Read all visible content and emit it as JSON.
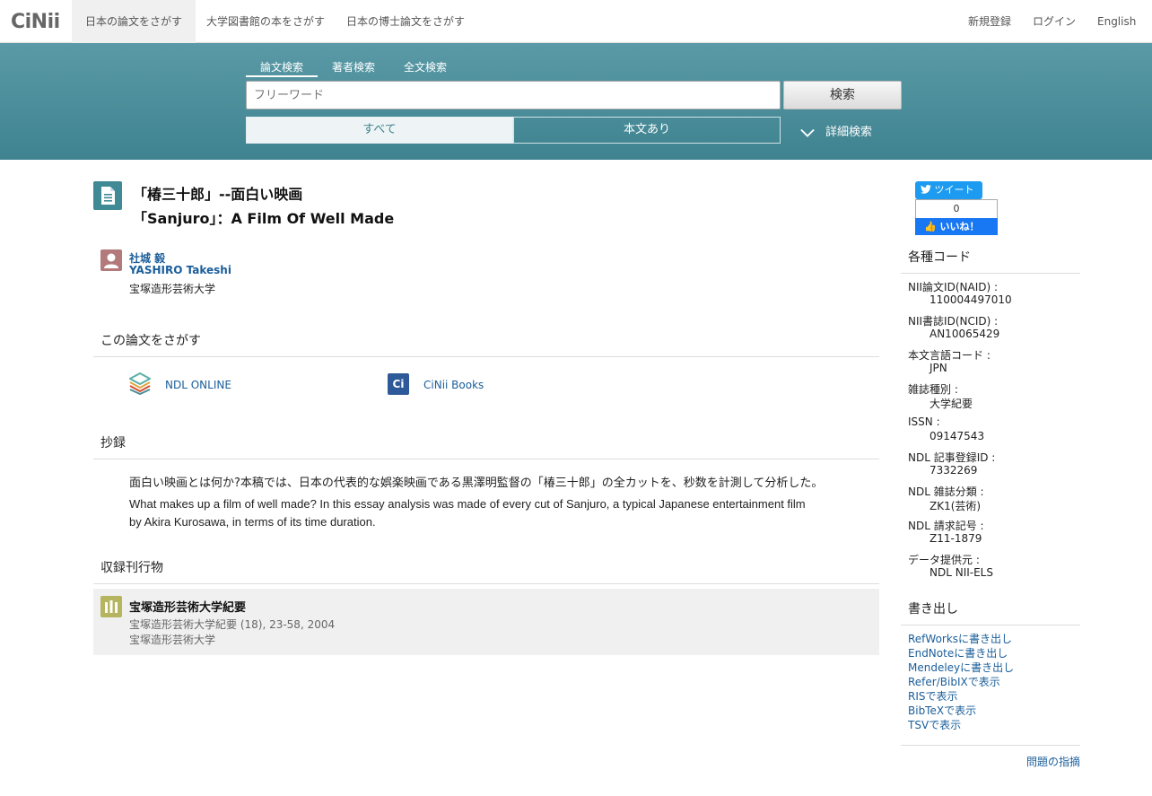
{
  "topnav": {
    "logo": "CiNii",
    "tabs": [
      "日本の論文をさがす",
      "大学図書館の本をさがす",
      "日本の博士論文をさがす"
    ],
    "register": "新規登録",
    "login": "ログイン",
    "language": "English"
  },
  "search": {
    "tabs": [
      "論文検索",
      "著者検索",
      "全文検索"
    ],
    "placeholder": "フリーワード",
    "button": "検索",
    "filter_all": "すべて",
    "filter_body": "本文あり",
    "advanced": "詳細検索"
  },
  "article": {
    "title_ja": "「椿三十郎」--面白い映画",
    "title_en": "「Sanjuro」：A Film Of Well Made",
    "author_ja": "社城 毅",
    "author_en": "YASHIRO Takeshi",
    "affiliation": "宝塚造形芸術大学"
  },
  "find": {
    "heading": "この論文をさがす",
    "ndl": "NDL ONLINE",
    "cinii_books": "CiNii Books",
    "cinii_icon": "Ci"
  },
  "abstract": {
    "heading": "抄録",
    "ja": "面白い映画とは何か?本稿では、日本の代表的な娯楽映画である黒澤明監督の「椿三十郎」の全カットを、秒数を計測して分析した。",
    "en": "What makes up a film of well made? In this essay analysis was made of every cut of Sanjuro, a typical Japanese entertainment film by Akira Kurosawa, in terms of its time duration."
  },
  "journal": {
    "heading": "収録刊行物",
    "title": "宝塚造形芸術大学紀要",
    "citation": "宝塚造形芸術大学紀要 (18), 23-58, 2004",
    "publisher": "宝塚造形芸術大学"
  },
  "social": {
    "tweet": "ツイート",
    "like_count": "0",
    "like": "いいね！"
  },
  "codes": {
    "heading": "各種コード",
    "items": [
      {
        "label": "NII論文ID(NAID) :",
        "value": "110004497010"
      },
      {
        "label": "NII書誌ID(NCID) :",
        "value": "AN10065429"
      },
      {
        "label": "本文言語コード :",
        "value": "JPN"
      },
      {
        "label": "雑誌種別 :",
        "value": "大学紀要"
      },
      {
        "label": "ISSN :",
        "value": "09147543"
      },
      {
        "label": "NDL 記事登録ID :",
        "value": "7332269"
      },
      {
        "label": "NDL 雑誌分類 :",
        "value": "ZK1(芸術)"
      },
      {
        "label": "NDL 請求記号 :",
        "value": "Z11-1879"
      },
      {
        "label": "データ提供元 :",
        "value": "NDL  NII-ELS"
      }
    ]
  },
  "export": {
    "heading": "書き出し",
    "links": [
      "RefWorksに書き出し",
      "EndNoteに書き出し",
      "Mendeleyに書き出し",
      "Refer/BibIXで表示",
      "RISで表示",
      "BibTeXで表示",
      "TSVで表示"
    ]
  },
  "report": "問題の指摘",
  "colors": {
    "band": "#4a8c98",
    "link": "#1a5e9a"
  }
}
